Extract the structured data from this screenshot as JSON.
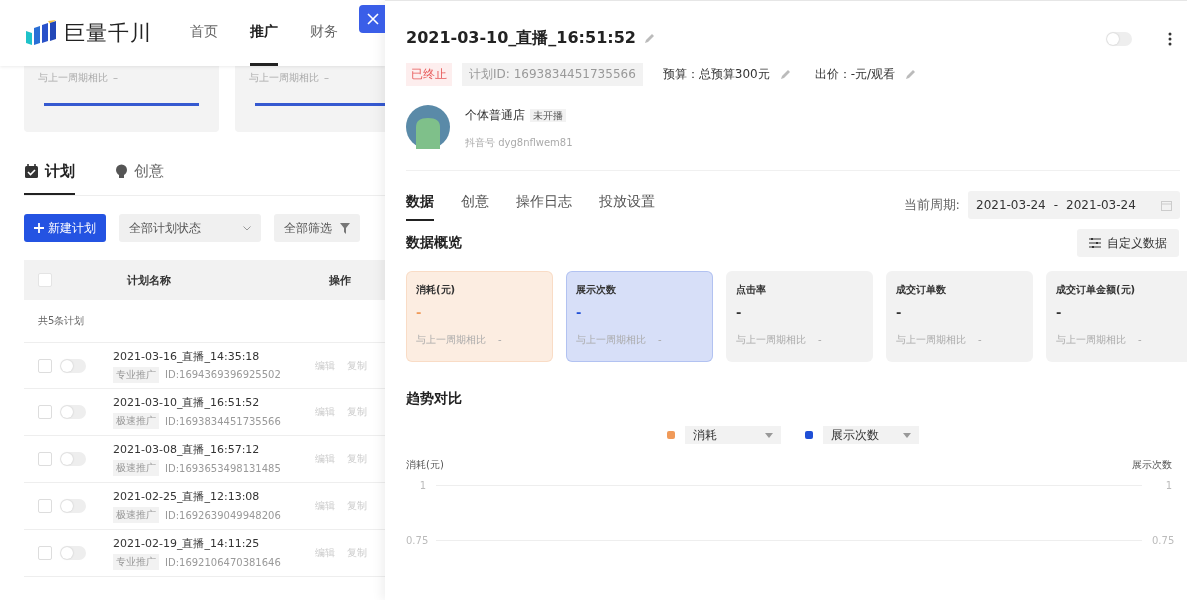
{
  "left": {
    "brand": "巨量千川",
    "nav": [
      {
        "label": "首页",
        "selected": false
      },
      {
        "label": "推广",
        "selected": true
      },
      {
        "label": "财务",
        "selected": false
      }
    ],
    "summary_cards": [
      {
        "compare_label": "与上一周期相比",
        "compare_value": "–"
      },
      {
        "compare_label": "与上一周期相比",
        "compare_value": "–"
      }
    ],
    "tabs": [
      {
        "label": "计划",
        "selected": true,
        "kind": "calendar"
      },
      {
        "label": "创意",
        "selected": false,
        "kind": "bulb"
      }
    ],
    "new_button": "新建计划",
    "status_filter": "全部计划状态",
    "all_filter": "全部筛选",
    "table": {
      "select_all_checked": false,
      "columns": [
        "计划名称",
        "操作"
      ],
      "total": "共5条计划",
      "rows": [
        {
          "name": "2021-03-16_直播_14:35:18",
          "tag": "专业推广",
          "id": "ID:1694369396925502",
          "checked": false,
          "on": false,
          "actions": [
            "编辑",
            "复制"
          ]
        },
        {
          "name": "2021-03-10_直播_16:51:52",
          "tag": "极速推广",
          "id": "ID:1693834451735566",
          "checked": false,
          "on": false,
          "actions": [
            "编辑",
            "复制"
          ]
        },
        {
          "name": "2021-03-08_直播_16:57:12",
          "tag": "极速推广",
          "id": "ID:1693653498131485",
          "checked": false,
          "on": false,
          "actions": [
            "编辑",
            "复制"
          ]
        },
        {
          "name": "2021-02-25_直播_12:13:08",
          "tag": "极速推广",
          "id": "ID:1692639049948206",
          "checked": false,
          "on": false,
          "actions": [
            "编辑",
            "复制"
          ]
        },
        {
          "name": "2021-02-19_直播_14:11:25",
          "tag": "专业推广",
          "id": "ID:1692106470381646",
          "checked": false,
          "on": false,
          "actions": [
            "编辑",
            "复制"
          ]
        }
      ]
    }
  },
  "drawer": {
    "title": "2021-03-10_直播_16:51:52",
    "on": false,
    "status": "已终止",
    "plan_id": "计划ID: 1693834451735566",
    "budget": "预算：总预算300元",
    "bid": "出价：-元/观看",
    "account": {
      "name": "个体普通店",
      "badge": "未开播",
      "handle": "抖音号 dyg8nflwem81"
    },
    "tabs": [
      {
        "label": "数据",
        "selected": true
      },
      {
        "label": "创意",
        "selected": false
      },
      {
        "label": "操作日志",
        "selected": false
      },
      {
        "label": "投放设置",
        "selected": false
      }
    ],
    "period_label": "当前周期:",
    "period_start": "2021-03-24",
    "period_sep": "-",
    "period_end": "2021-03-24",
    "overview_title": "数据概览",
    "customize_button": "自定义数据",
    "metrics": [
      {
        "label": "消耗(元)",
        "value": "-",
        "compare_label": "与上一周期相比",
        "compare_value": "-",
        "selected": true,
        "color": "#f09a59"
      },
      {
        "label": "展示次数",
        "value": "-",
        "compare_label": "与上一周期相比",
        "compare_value": "-",
        "selected": true,
        "color": "#1f4fd6"
      },
      {
        "label": "点击率",
        "value": "-",
        "compare_label": "与上一周期相比",
        "compare_value": "-",
        "selected": false,
        "color": "#333333"
      },
      {
        "label": "成交订单数",
        "value": "-",
        "compare_label": "与上一周期相比",
        "compare_value": "-",
        "selected": false,
        "color": "#333333"
      },
      {
        "label": "成交订单金额(元)",
        "value": "-",
        "compare_label": "与上一周期相比",
        "compare_value": "-",
        "selected": false,
        "color": "#333333"
      }
    ],
    "trend_title": "趋势对比",
    "legend": [
      {
        "label": "消耗",
        "color": "#f09a59"
      },
      {
        "label": "展示次数",
        "color": "#1f4fd6"
      }
    ],
    "chart": {
      "left_axis_title": "消耗(元)",
      "right_axis_title": "展示次数",
      "left_ticks": [
        "1",
        "0.75"
      ],
      "right_ticks": [
        "1",
        "0.75"
      ]
    }
  }
}
